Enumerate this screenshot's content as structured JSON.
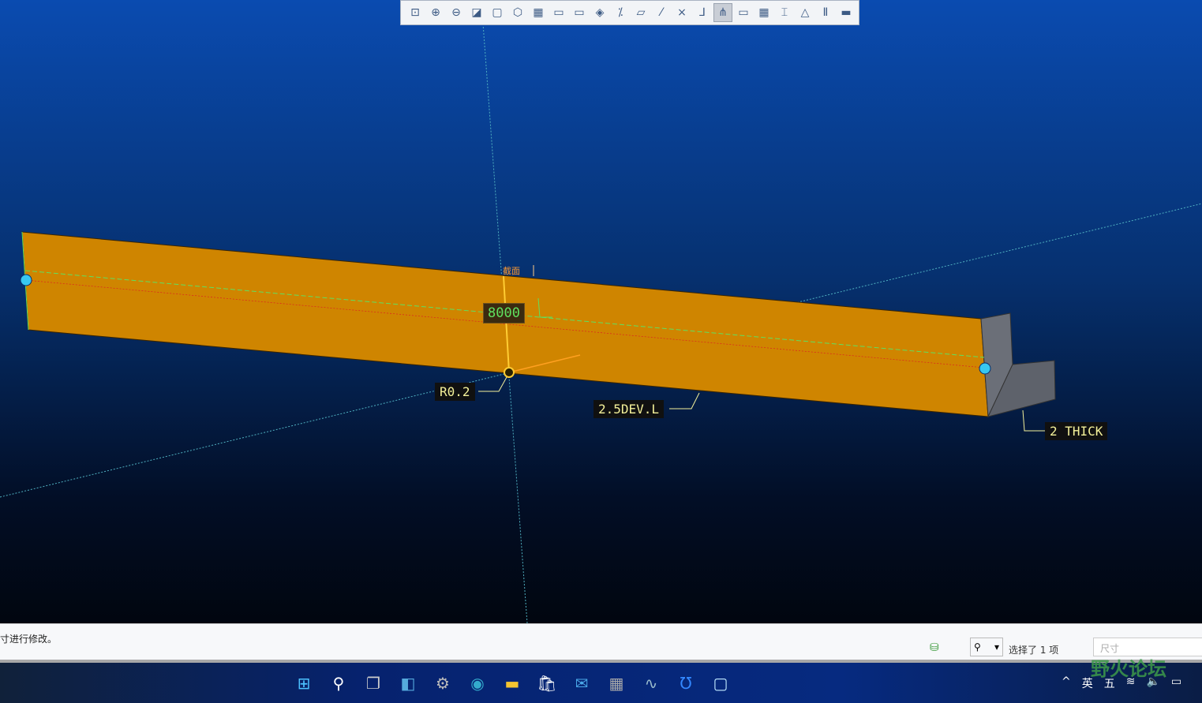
{
  "toolbar": {
    "icons": [
      "refit-icon",
      "zoom-in-icon",
      "zoom-out-icon",
      "repaint-icon",
      "display-style-icon",
      "saved-views-icon",
      "view-manager-icon",
      "next-view-icon",
      "previous-view-icon",
      "appearance-icon",
      "datum-display-icon",
      "plane-display-icon",
      "axis-display-icon",
      "point-display-icon",
      "csys-display-icon",
      "spin-center-icon",
      "annotation-display-icon",
      "model-tree-filter-icon",
      "dimension-icon",
      "warning-icon",
      "pause-icon",
      "stop-icon"
    ],
    "active_index": 15
  },
  "viewport": {
    "section_label": "截面",
    "dimension_value": "8000",
    "annotations": [
      "R0.2",
      "2.5DEV.L",
      "2 THICK"
    ],
    "colors": {
      "beam": "#cf8500",
      "flange": "#6b6f78",
      "dim": "#5fe05f"
    }
  },
  "status": {
    "message": "寸进行修改。",
    "selection": "选择了 1 项",
    "filter_placeholder": "尺寸"
  },
  "taskbar": {
    "apps": [
      "start-icon",
      "search-icon",
      "task-view-icon",
      "widgets-icon",
      "settings-icon",
      "edge-icon",
      "file-explorer-icon",
      "store-icon",
      "mail-icon",
      "calculator-icon",
      "performance-monitor-icon",
      "app-icon",
      "creo-icon"
    ],
    "tray": {
      "chevron": "^",
      "lang": "英",
      "ime": "五"
    }
  },
  "watermark": {
    "text": "野火论坛",
    "url": "www.proewildfire.cn"
  }
}
